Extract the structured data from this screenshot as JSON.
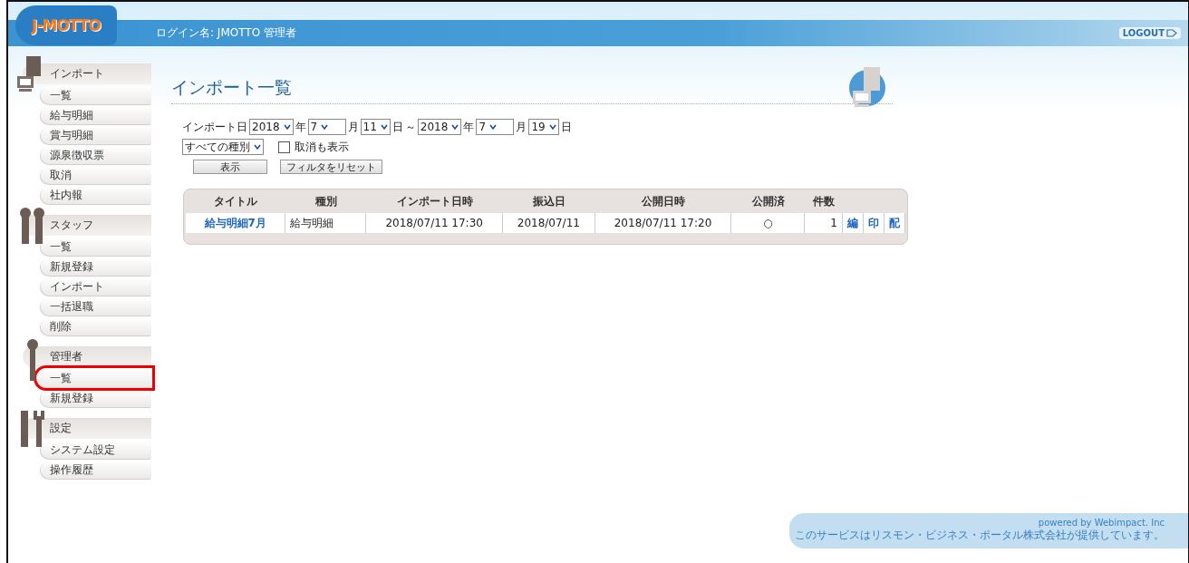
{
  "header": {
    "logo": "J-MOTTO",
    "login_label": "ログイン名: JMOTTO  管理者",
    "logout": "LOGOUT"
  },
  "sidebar": [
    {
      "kind": "import",
      "title": "インポート",
      "items": [
        {
          "label": "一覧",
          "highlighted": false
        },
        {
          "label": "給与明細",
          "highlighted": false
        },
        {
          "label": "賞与明細",
          "highlighted": false
        },
        {
          "label": "源泉徴収票",
          "highlighted": false
        },
        {
          "label": "取消",
          "highlighted": false
        },
        {
          "label": "社内報",
          "highlighted": false
        }
      ]
    },
    {
      "kind": "staff",
      "title": "スタッフ",
      "items": [
        {
          "label": "一覧",
          "highlighted": false
        },
        {
          "label": "新規登録",
          "highlighted": false
        },
        {
          "label": "インポート",
          "highlighted": false
        },
        {
          "label": "一括退職",
          "highlighted": false
        },
        {
          "label": "削除",
          "highlighted": false
        }
      ]
    },
    {
      "kind": "admin",
      "title": "管理者",
      "items": [
        {
          "label": "一覧",
          "highlighted": true
        },
        {
          "label": "新規登録",
          "highlighted": false
        }
      ]
    },
    {
      "kind": "settings",
      "title": "設定",
      "items": [
        {
          "label": "システム設定",
          "highlighted": false
        },
        {
          "label": "操作履歴",
          "highlighted": false
        }
      ]
    }
  ],
  "page": {
    "title": "インポート一覧",
    "filter": {
      "label": "インポート日",
      "from": [
        {
          "value": "2018",
          "unit": "年"
        },
        {
          "value": "7",
          "unit": "月"
        },
        {
          "value": "11",
          "unit": "日"
        }
      ],
      "separator": "～",
      "to": [
        {
          "value": "2018",
          "unit": "年"
        },
        {
          "value": "7",
          "unit": "月"
        },
        {
          "value": "19",
          "unit": "日"
        }
      ],
      "type_select": "すべての種別",
      "show_cancelled": {
        "label": "取消も表示",
        "checked": false
      },
      "buttons": [
        "表示",
        "フィルタをリセット"
      ]
    },
    "table": {
      "columns": [
        "タイトル",
        "種別",
        "インポート日時",
        "振込日",
        "公開日時",
        "公開済",
        "件数"
      ],
      "rows": [
        {
          "title": "給与明細7月",
          "type": "給与明細",
          "imported": "2018/07/11 17:30",
          "transfer_date": "2018/07/11",
          "published_at": "2018/07/11 17:20",
          "published": "○",
          "count": "1",
          "actions": [
            "編",
            "印",
            "配"
          ]
        }
      ]
    }
  },
  "footer": {
    "powered": "powered by Webimpact. Inc",
    "notice": "このサービスはリスモン・ビジネス・ポータル株式会社が提供しています。"
  }
}
